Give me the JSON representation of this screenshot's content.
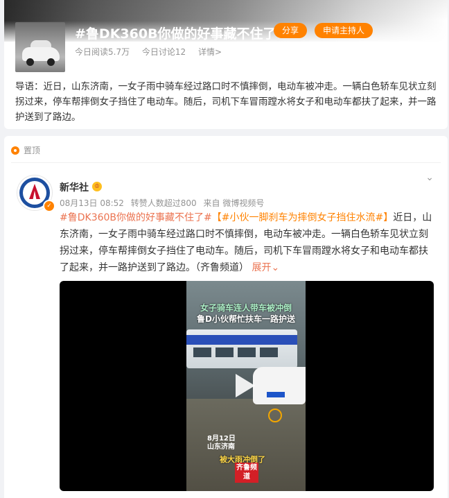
{
  "topic": {
    "title": "#鲁DK360B你做的好事藏不住了#",
    "share_label": "分享",
    "host_label": "申请主持人",
    "reads": "今日阅读5.7万",
    "discussions": "今日讨论12",
    "details": "详情>",
    "lead": "导语：近日，山东济南，一女子雨中骑车经过路口时不慎摔倒，电动车被冲走。一辆白色轿车见状立刻拐过来，停车帮摔倒女子挡住了电动车。随后，司机下车冒雨蹚水将女子和电动车都扶了起来，并一路护送到了路边。"
  },
  "feed": {
    "pinned_label": "置顶",
    "post": {
      "author": "新华社",
      "more_icon": "⌄",
      "time": "08月13日 08:52",
      "reposts": "转赞人数超过800",
      "source": "来自 微博视频号",
      "tag1": "#鲁DK360B你做的好事藏不住了#",
      "tag2": "【#小伙一脚刹车为摔倒女子挡住水流#】",
      "text": "近日，山东济南，一女子雨中骑车经过路口时不慎摔倒，电动车被冲走。一辆白色轿车见状立刻拐过来，停车帮摔倒女子挡住了电动车。随后，司机下车冒雨蹚水将女子和电动车都扶了起来，并一路护送到了路边。（齐鲁频道）",
      "expand": "展开"
    },
    "video": {
      "caption1": "女子骑车连人带车被冲倒",
      "caption2": "鲁D小伙帮忙扶车一路护送",
      "date": "8月12日",
      "location": "山东济南",
      "subtitle": "被大雨冲倒了",
      "logo": "齐鲁频道"
    }
  }
}
